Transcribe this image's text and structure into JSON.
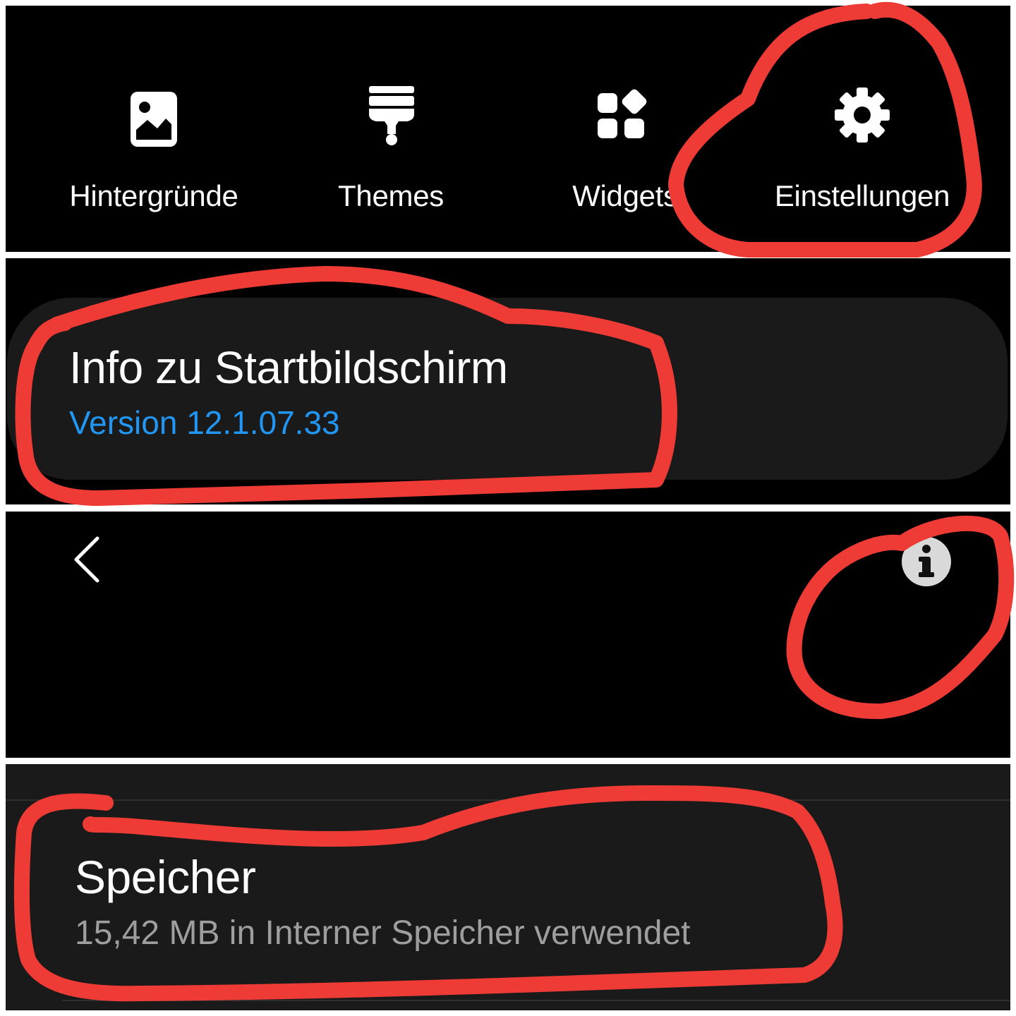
{
  "launcher_menu": {
    "items": [
      {
        "label": "Hintergründe",
        "icon": "wallpaper-icon"
      },
      {
        "label": "Themes",
        "icon": "paint-brush-icon"
      },
      {
        "label": "Widgets",
        "icon": "widgets-icon"
      },
      {
        "label": "Einstellungen",
        "icon": "gear-icon"
      }
    ]
  },
  "about": {
    "title": "Info zu Startbildschirm",
    "version": "Version 12.1.07.33",
    "version_color": "#2196f3"
  },
  "app_bar": {
    "back_icon": "chevron-left-icon",
    "info_icon": "info-icon"
  },
  "storage": {
    "title": "Speicher",
    "usage": "15,42 MB in Interner Speicher verwendet"
  },
  "colors": {
    "annotation": "#ee3b35",
    "background": "#000000",
    "card": "#1a1a1a"
  }
}
